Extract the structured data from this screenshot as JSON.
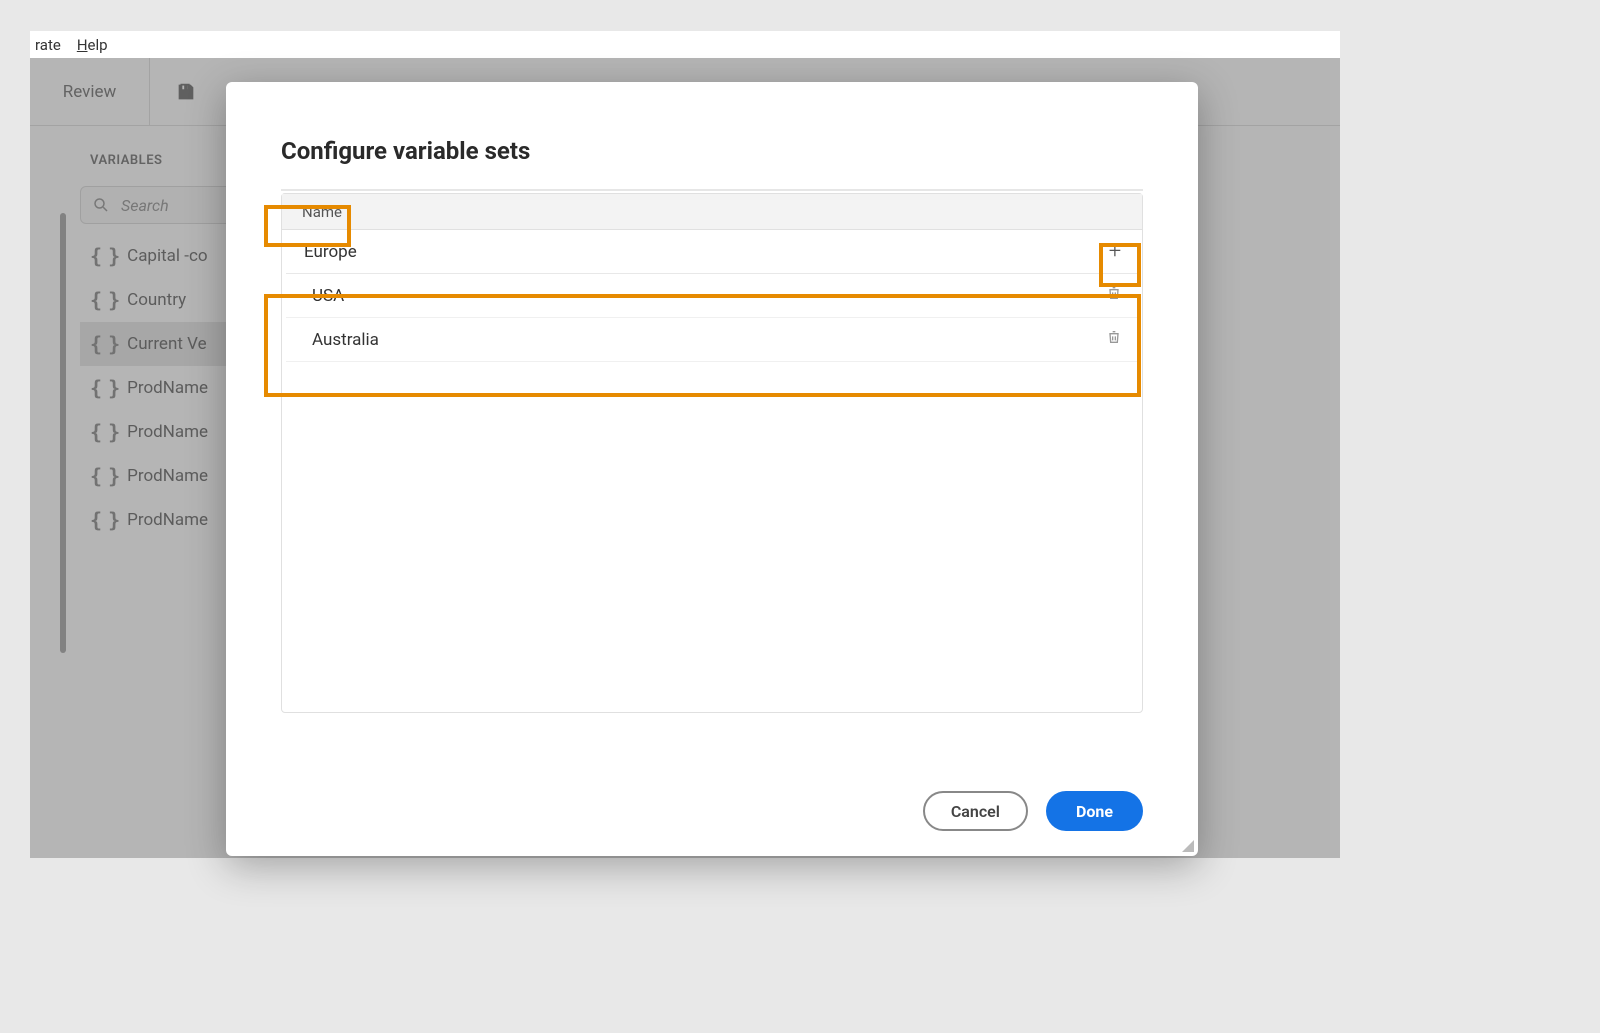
{
  "menubar": {
    "item1": "rate",
    "item2_prefix": "H",
    "item2_rest": "elp"
  },
  "toolbar": {
    "review_tab": "Review"
  },
  "sidebar": {
    "title": "VARIABLES",
    "search_placeholder": "Search",
    "items": [
      {
        "label": "Capital -co"
      },
      {
        "label": "Country"
      },
      {
        "label": "Current Ve"
      },
      {
        "label": "ProdName"
      },
      {
        "label": "ProdName"
      },
      {
        "label": "ProdName"
      },
      {
        "label": "ProdName"
      }
    ],
    "selected_index": 2
  },
  "modal": {
    "title": "Configure variable sets",
    "name_header": "Name",
    "new_set_value": "Europe",
    "sets": [
      {
        "name": "USA"
      },
      {
        "name": "Australia"
      }
    ],
    "cancel_label": "Cancel",
    "done_label": "Done"
  }
}
